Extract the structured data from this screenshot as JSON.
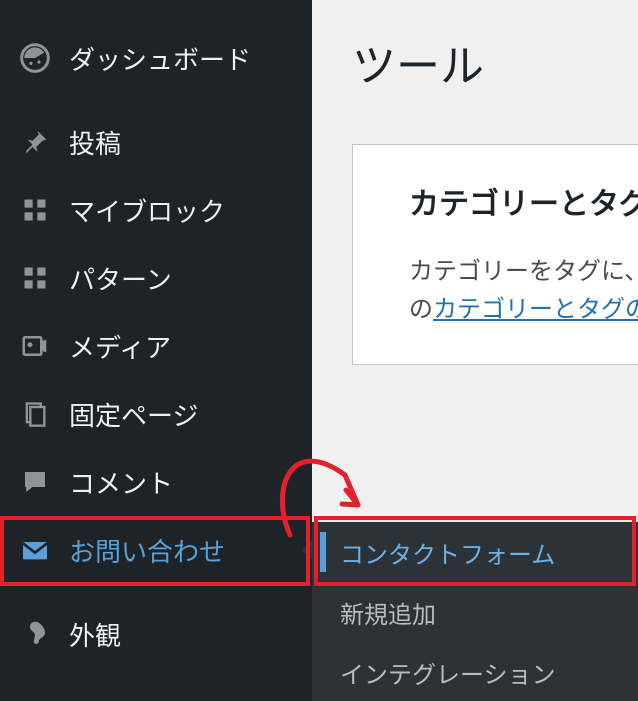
{
  "sidebar": {
    "items": [
      {
        "label": "ダッシュボード",
        "icon": "dashboard-icon"
      },
      {
        "label": "投稿",
        "icon": "pin-icon"
      },
      {
        "label": "マイブロック",
        "icon": "grid-icon"
      },
      {
        "label": "パターン",
        "icon": "grid-icon"
      },
      {
        "label": "メディア",
        "icon": "media-icon"
      },
      {
        "label": "固定ページ",
        "icon": "pages-icon"
      },
      {
        "label": "コメント",
        "icon": "comment-icon"
      },
      {
        "label": "お問い合わせ",
        "icon": "mail-icon",
        "selected": true
      },
      {
        "label": "外観",
        "icon": "brush-icon"
      }
    ]
  },
  "submenu": {
    "items": [
      {
        "label": "コンタクトフォーム",
        "active": true
      },
      {
        "label": "新規追加"
      },
      {
        "label": "インテグレーション"
      }
    ]
  },
  "main": {
    "page_title": "ツール",
    "panel_heading": "カテゴリーとタグ",
    "panel_text_prefix": "カテゴリーをタグに、",
    "panel_text_line2_prefix": "の",
    "panel_link_text": "カテゴリーとタグの"
  }
}
